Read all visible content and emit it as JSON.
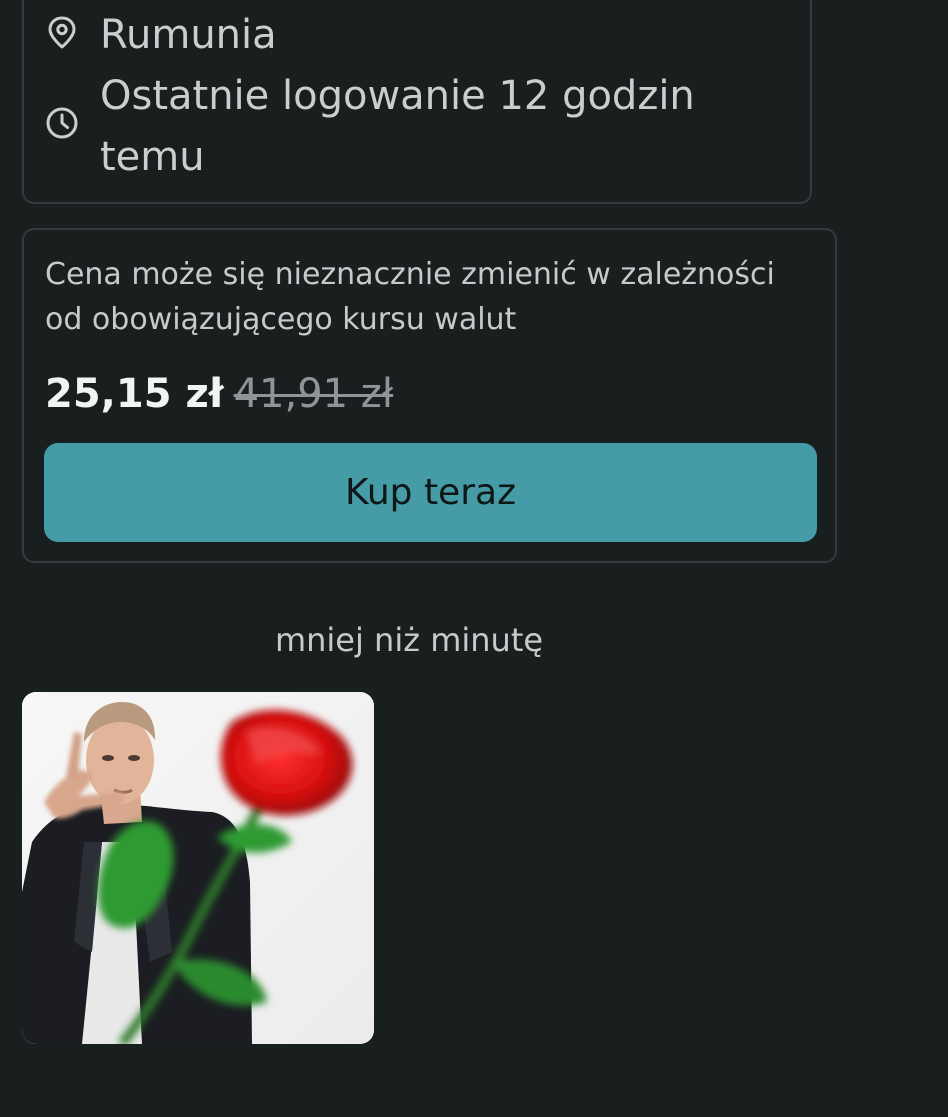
{
  "seller": {
    "location": "Rumunia",
    "location_icon": "location-pin-icon",
    "last_login_line1": "Ostatnie logowanie 12 godzin",
    "last_login_line2": "temu",
    "last_login_icon": "clock-icon"
  },
  "price_card": {
    "note_line1": "Cena może się nieznacznie zmienić w zależności",
    "note_line2": "od obowiązującego kursu walut",
    "current_price": "25,15 zł",
    "old_price": "41,91 zł",
    "buy_label": "Kup teraz"
  },
  "chat": {
    "timestamp": "mniej niż minutę"
  },
  "colors": {
    "background": "#191e1f",
    "card_border": "#343b3d",
    "accent": "#459ca6",
    "text": "#c9cecf"
  }
}
